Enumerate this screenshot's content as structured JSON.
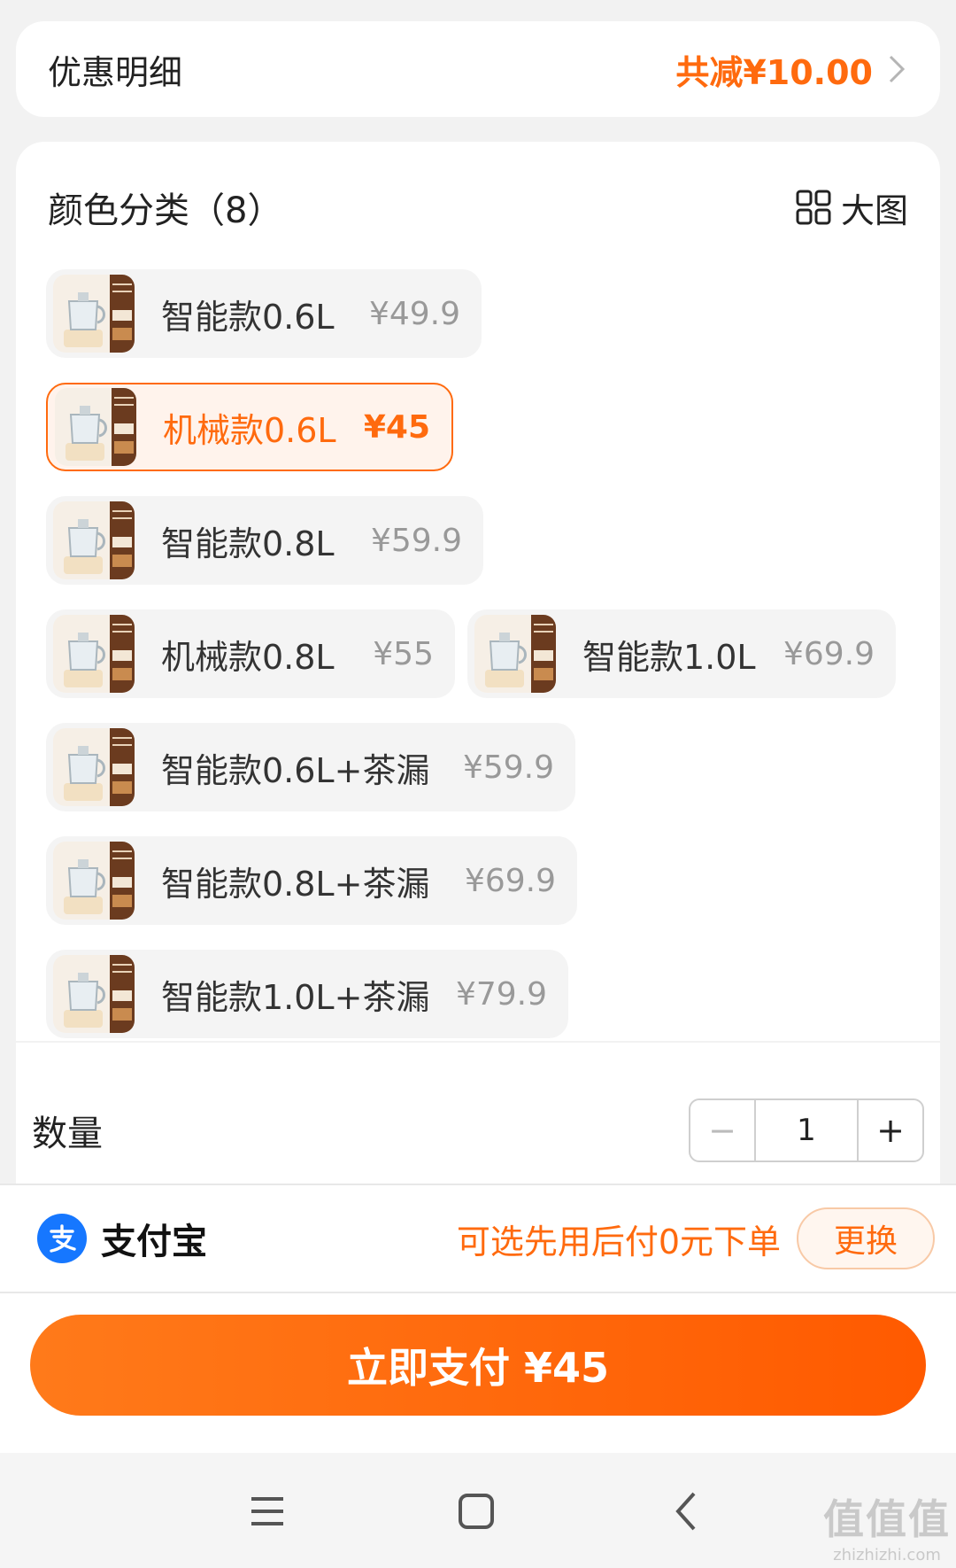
{
  "discount": {
    "title": "优惠明细",
    "amount": "共减¥10.00"
  },
  "sku": {
    "title": "颜色分类（8）",
    "big_view_label": "大图",
    "options": [
      {
        "name": "智能款0.6L",
        "price": "¥49.9",
        "selected": false
      },
      {
        "name": "机械款0.6L",
        "price": "¥45",
        "selected": true
      },
      {
        "name": "智能款0.8L",
        "price": "¥59.9",
        "selected": false
      },
      {
        "name": "机械款0.8L",
        "price": "¥55",
        "selected": false
      },
      {
        "name": "智能款1.0L",
        "price": "¥69.9",
        "selected": false
      },
      {
        "name": "智能款0.6L+茶漏",
        "price": "¥59.9",
        "selected": false
      },
      {
        "name": "智能款0.8L+茶漏",
        "price": "¥69.9",
        "selected": false
      },
      {
        "name": "智能款1.0L+茶漏",
        "price": "¥79.9",
        "selected": false
      }
    ]
  },
  "quantity": {
    "label": "数量",
    "value": "1",
    "minus": "−",
    "plus": "+"
  },
  "payment": {
    "method": "支付宝",
    "hint": "可选先用后付0元下单",
    "change_label": "更换"
  },
  "submit": {
    "label": "立即支付 ¥45"
  },
  "watermark": {
    "brand": "值值值",
    "site": "zhizhizhi.com"
  },
  "colors": {
    "accent": "#ff6a0e",
    "alipay": "#1677ff"
  }
}
